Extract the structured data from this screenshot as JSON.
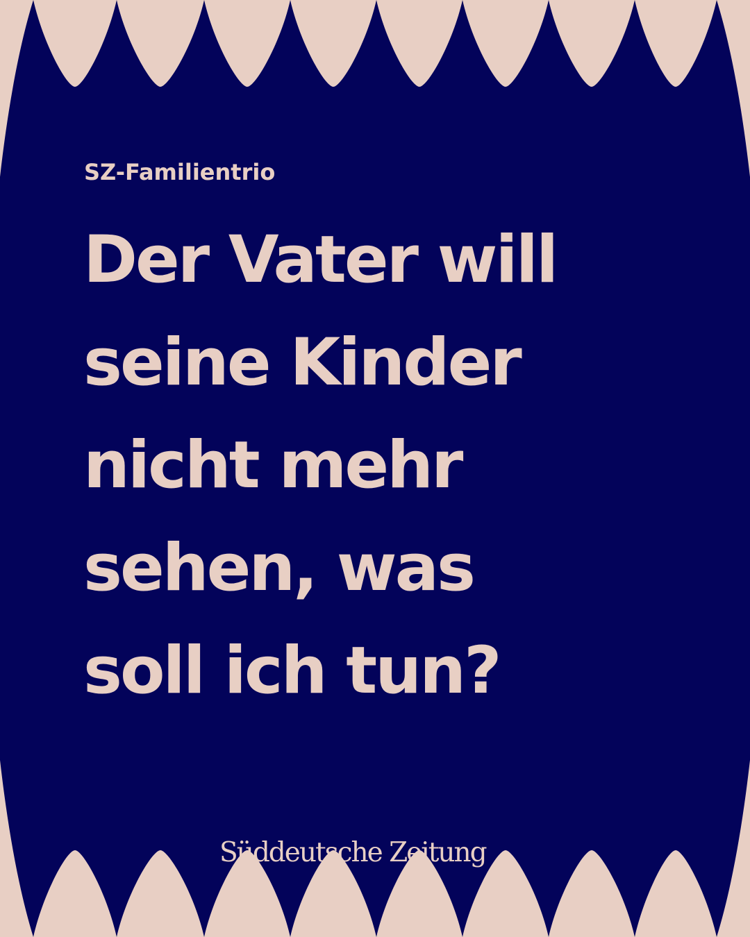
{
  "card": {
    "kicker": "SZ-Familientrio",
    "headline_lines": [
      "Der Vater will",
      "seine Kinder",
      "nicht mehr",
      "sehen, was",
      "soll ich tun?"
    ],
    "logo": "Süddeutsche Zeitung"
  },
  "colors": {
    "background": "#e8cfc4",
    "shape": "#03035a",
    "text": "#e8cfc4"
  }
}
